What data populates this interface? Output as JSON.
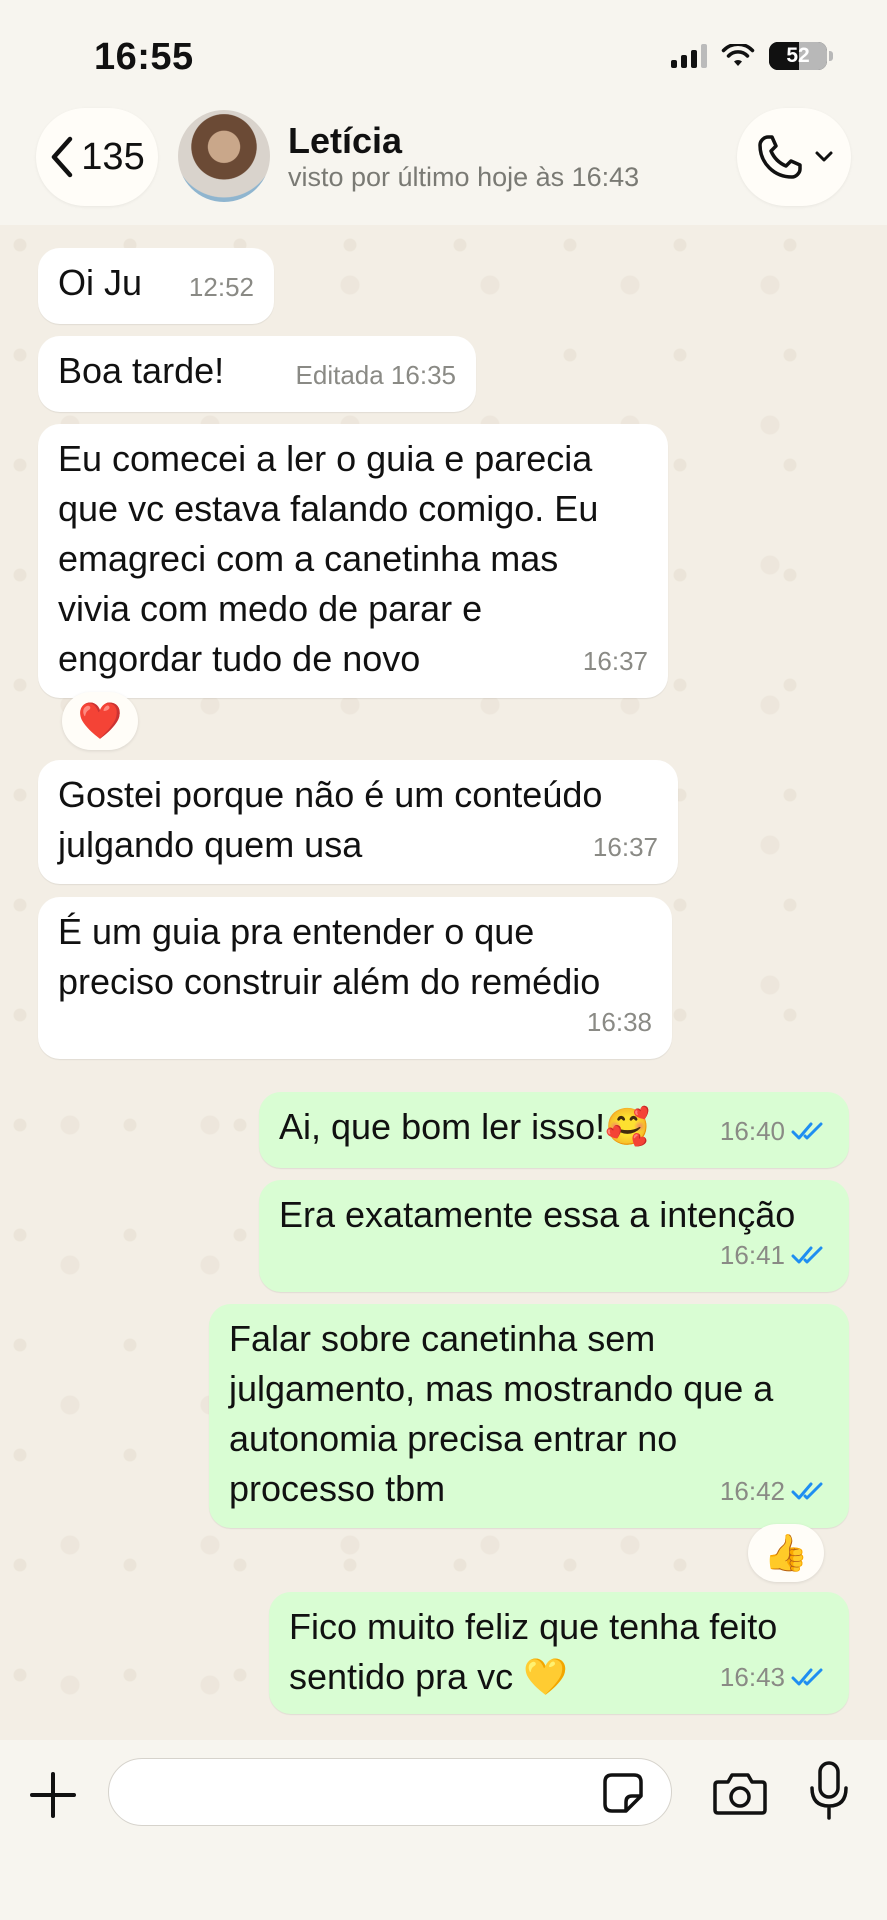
{
  "status_bar": {
    "time": "16:55",
    "battery": "52"
  },
  "header": {
    "back_count": "135",
    "contact_name": "Letícia",
    "contact_status": "visto por último hoje às 16:43"
  },
  "messages": [
    {
      "dir": "in",
      "text": "Oi Ju",
      "time": "12:52"
    },
    {
      "dir": "in",
      "text": "Boa tarde!",
      "time": "Editada 16:35"
    },
    {
      "dir": "in",
      "text": "Eu comecei a ler o guia e parecia\nque vc estava falando comigo. Eu\nemagreci com a canetinha mas\nvivia com medo de parar e\nengordar tudo de novo",
      "time": "16:37",
      "reaction": "❤️"
    },
    {
      "dir": "in",
      "text": "Gostei porque não é um conteúdo\njulgando quem usa",
      "time": "16:37"
    },
    {
      "dir": "in",
      "text": "É um guia pra entender o que\npreciso construir além do remédio",
      "time": "16:38"
    },
    {
      "dir": "out",
      "text": "Ai, que bom ler isso!🥰",
      "time": "16:40"
    },
    {
      "dir": "out",
      "text": "Era exatamente essa a intenção",
      "time": "16:41"
    },
    {
      "dir": "out",
      "text": "Falar sobre canetinha sem\njulgamento, mas mostrando que a\nautonomia precisa entrar no\nprocesso tbm",
      "time": "16:42",
      "reaction": "👍"
    },
    {
      "dir": "out",
      "text": "Fico muito feliz que tenha feito\nsentido pra vc 💛",
      "time": "16:43"
    }
  ],
  "composer": {
    "placeholder": ""
  },
  "colors": {
    "incoming": "#ffffff",
    "outgoing": "#d9fdd3",
    "read_ticks": "#1f8ef1",
    "header_bg": "#f7f5ef"
  }
}
